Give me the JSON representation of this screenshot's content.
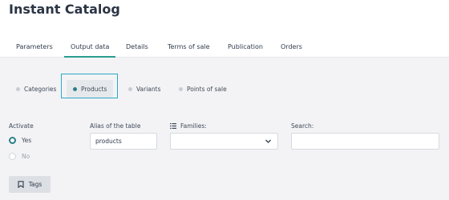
{
  "app": {
    "title": "Instant Catalog"
  },
  "tabs": [
    {
      "label": "Parameters"
    },
    {
      "label": "Output data"
    },
    {
      "label": "Details"
    },
    {
      "label": "Terms of sale"
    },
    {
      "label": "Publication"
    },
    {
      "label": "Orders"
    }
  ],
  "active_tab": "Output data",
  "subtabs": [
    {
      "label": "Categories"
    },
    {
      "label": "Products"
    },
    {
      "label": "Variants"
    },
    {
      "label": "Points of sale"
    }
  ],
  "active_subtab": "Products",
  "form": {
    "activate": {
      "label": "Activate",
      "options": [
        {
          "label": "Yes",
          "checked": true
        },
        {
          "label": "No",
          "checked": false
        }
      ]
    },
    "alias": {
      "label": "Alias of the table",
      "value": "products"
    },
    "families": {
      "label": "Families:",
      "value": ""
    },
    "search": {
      "label": "Search:",
      "value": ""
    }
  },
  "tags_button": {
    "label": "Tags"
  },
  "colors": {
    "accent": "#2a7f8a",
    "highlight": "#27a9c9",
    "content_bg": "#f3f3f5"
  }
}
